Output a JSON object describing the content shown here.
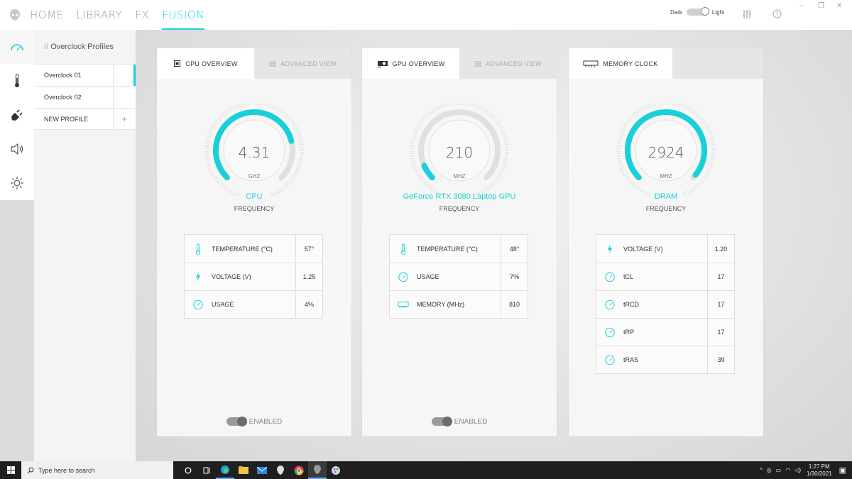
{
  "nav": {
    "items": [
      {
        "label": "HOME",
        "active": false
      },
      {
        "label": "LIBRARY",
        "active": false
      },
      {
        "label": "FX",
        "active": false
      },
      {
        "label": "FUSION",
        "active": true
      }
    ]
  },
  "theme": {
    "dark_label": "Dark",
    "light_label": "Light"
  },
  "profiles": {
    "title_prefix": "//",
    "title": "Overclock Profiles",
    "items": [
      {
        "label": "Overclock 01",
        "active": true
      },
      {
        "label": "Overclock 02",
        "active": false
      },
      {
        "label": "NEW PROFILE",
        "active": false
      }
    ]
  },
  "cards": [
    {
      "tabs": [
        {
          "label": "CPU OVERVIEW"
        },
        {
          "label": "ADVANCED VIEW"
        }
      ],
      "gauge": {
        "value": "4.31",
        "unit": "GHZ",
        "name": "CPU",
        "sub": "FREQUENCY",
        "fill_fraction": 0.78
      },
      "stats": [
        {
          "label": "TEMPERATURE (°C)",
          "value": "57°",
          "icon": "thermometer-icon"
        },
        {
          "label": "VOLTAGE (V)",
          "value": "1.25",
          "icon": "lightning-icon"
        },
        {
          "label": "USAGE",
          "value": "4%",
          "icon": "speedometer-icon"
        }
      ],
      "enabled_label": "ENABLED"
    },
    {
      "tabs": [
        {
          "label": "GPU OVERVIEW"
        },
        {
          "label": "ADVANCED VIEW"
        }
      ],
      "gauge": {
        "value": "210",
        "unit": "MHZ",
        "name": "GeForce RTX 3080 Laptop GPU",
        "sub": "FREQUENCY",
        "fill_fraction": 0.08
      },
      "stats": [
        {
          "label": "TEMPERATURE (°C)",
          "value": "48°",
          "icon": "thermometer-icon"
        },
        {
          "label": "USAGE",
          "value": "7%",
          "icon": "speedometer-icon"
        },
        {
          "label": "MEMORY (MHz)",
          "value": "810",
          "icon": "memory-icon"
        }
      ],
      "enabled_label": "ENABLED"
    },
    {
      "tabs": [
        {
          "label": "MEMORY CLOCK"
        }
      ],
      "gauge": {
        "value": "2924",
        "unit": "MHZ",
        "name": "DRAM",
        "sub": "FREQUENCY",
        "fill_fraction": 0.98
      },
      "stats": [
        {
          "label": "VOLTAGE (V)",
          "value": "1.20",
          "icon": "lightning-icon"
        },
        {
          "label": "tCL",
          "value": "17",
          "icon": "speedometer-icon"
        },
        {
          "label": "tRCD",
          "value": "17",
          "icon": "speedometer-icon"
        },
        {
          "label": "tRP",
          "value": "17",
          "icon": "speedometer-icon"
        },
        {
          "label": "tRAS",
          "value": "39",
          "icon": "speedometer-icon"
        }
      ]
    }
  ],
  "taskbar": {
    "search_placeholder": "Type here to search",
    "time": "1:27 PM",
    "date": "1/30/2021"
  },
  "colors": {
    "accent": "#18d0d8",
    "track": "#e0e0e0"
  }
}
